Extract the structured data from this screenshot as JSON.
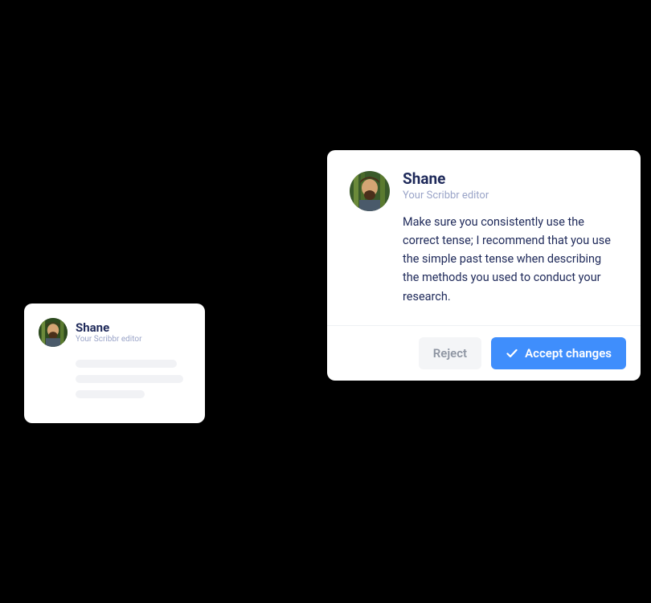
{
  "editor": {
    "name": "Shane",
    "role": "Your Scribbr editor"
  },
  "comment": {
    "text": "Make sure you consistently use the correct tense; I recommend that you use the simple past tense when describing the methods you used to conduct your research."
  },
  "actions": {
    "reject": "Reject",
    "accept": "Accept changes"
  },
  "colors": {
    "primary": "#3f8efc",
    "text": "#1f2a5a",
    "muted": "#9aa4c8"
  }
}
